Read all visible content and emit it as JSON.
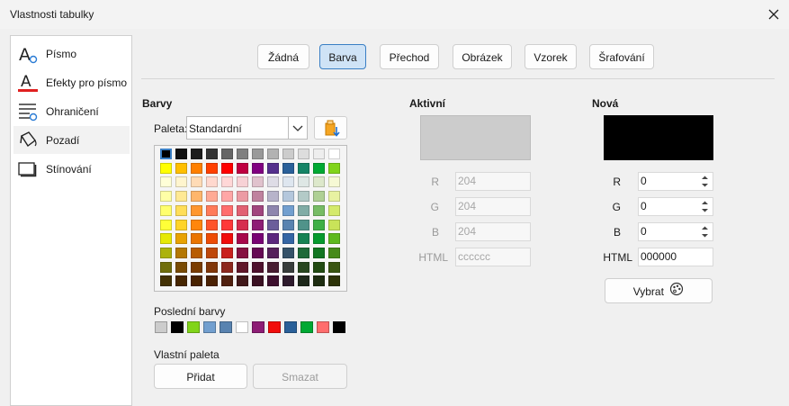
{
  "dialog": {
    "title": "Vlastnosti tabulky"
  },
  "sidebar": {
    "items": [
      {
        "label": "Písmo"
      },
      {
        "label": "Efekty pro písmo"
      },
      {
        "label": "Ohraničení"
      },
      {
        "label": "Pozadí"
      },
      {
        "label": "Stínování"
      }
    ]
  },
  "tabs": [
    {
      "label": "Žádná"
    },
    {
      "label": "Barva"
    },
    {
      "label": "Přechod"
    },
    {
      "label": "Obrázek"
    },
    {
      "label": "Vzorek"
    },
    {
      "label": "Šrafování"
    }
  ],
  "colors": {
    "heading": "Barvy",
    "palette_label": "Paleta:",
    "palette_value": "Standardní",
    "recent_label": "Poslední barvy",
    "custom_label": "Vlastní paleta",
    "add_label": "Přidat",
    "delete_label": "Smazat",
    "palette_rows": [
      [
        "#000000",
        "#111111",
        "#1c1c1c",
        "#333333",
        "#666666",
        "#808080",
        "#999999",
        "#b2b2b2",
        "#cccccc",
        "#dddddd",
        "#eeeeee",
        "#ffffff"
      ],
      [
        "#ffff00",
        "#ffbf00",
        "#ff8000",
        "#ff4000",
        "#ff0000",
        "#bf0041",
        "#800080",
        "#55308d",
        "#2a6099",
        "#158466",
        "#00a933",
        "#81d41a"
      ],
      [
        "#ffffd7",
        "#fff5ce",
        "#ffdbb6",
        "#ffd8ce",
        "#ffd7d7",
        "#f7d1d5",
        "#e0c2cd",
        "#dedce6",
        "#dee6ef",
        "#dee7e5",
        "#dde8cb",
        "#f6f9d4"
      ],
      [
        "#ffffa6",
        "#ffe994",
        "#ffb66c",
        "#ffaa95",
        "#ffa6a6",
        "#ec9ba4",
        "#bf819e",
        "#b7b3ca",
        "#b4c7dc",
        "#b3cac7",
        "#afd095",
        "#e8f2a1"
      ],
      [
        "#ffff6d",
        "#ffde59",
        "#ff972f",
        "#ff7b59",
        "#ff6d6d",
        "#e16173",
        "#a1467e",
        "#8e86ae",
        "#729fcf",
        "#81aca6",
        "#77bc65",
        "#d4ea6b"
      ],
      [
        "#ffff38",
        "#ffd428",
        "#ff860d",
        "#ff5429",
        "#ff3838",
        "#d62e4e",
        "#8d1d75",
        "#6b5e9b",
        "#5983b0",
        "#50938a",
        "#3faf46",
        "#c9e359"
      ],
      [
        "#e6e905",
        "#e8a202",
        "#ea7500",
        "#ed4c05",
        "#f10d0c",
        "#a7074b",
        "#780373",
        "#5b277d",
        "#3465a4",
        "#168253",
        "#069a2e",
        "#5eb91e"
      ],
      [
        "#acb20c",
        "#b47804",
        "#b85c00",
        "#be480a",
        "#c9211e",
        "#861141",
        "#650953",
        "#55215b",
        "#355269",
        "#1e6a39",
        "#127622",
        "#468a1a"
      ],
      [
        "#706e0c",
        "#784b04",
        "#7b3d00",
        "#813709",
        "#8d281e",
        "#611729",
        "#4e102d",
        "#481d32",
        "#383d3c",
        "#28471f",
        "#224b12",
        "#395511"
      ],
      [
        "#443205",
        "#472702",
        "#492300",
        "#4b2204",
        "#50200f",
        "#41191a",
        "#3b1123",
        "#3d0f2e",
        "#2e1b2d",
        "#1e291b",
        "#1e2d11",
        "#2d3308"
      ]
    ],
    "recent": [
      "#cccccc",
      "#000000",
      "#81d41a",
      "#729fcf",
      "#5983b0",
      "#ffffff",
      "#8d1d75",
      "#f10d0c",
      "#2a6099",
      "#00a933",
      "#ff6d6d",
      "#000000"
    ]
  },
  "active": {
    "heading": "Aktivní",
    "color": "#cccccc",
    "r_label": "R",
    "g_label": "G",
    "b_label": "B",
    "html_label": "HTML",
    "r": "204",
    "g": "204",
    "b": "204",
    "html": "cccccc"
  },
  "new": {
    "heading": "Nová",
    "color": "#000000",
    "r_label": "R",
    "g_label": "G",
    "b_label": "B",
    "html_label": "HTML",
    "r": "0",
    "g": "0",
    "b": "0",
    "html": "000000",
    "pick_label": "Vybrat"
  }
}
